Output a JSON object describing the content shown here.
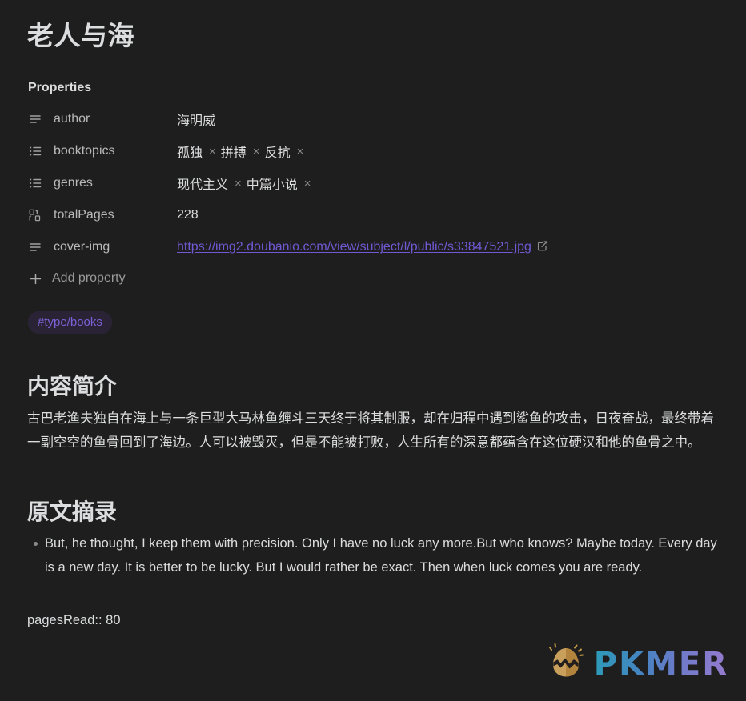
{
  "note": {
    "title": "老人与海"
  },
  "properties": {
    "heading": "Properties",
    "add_label": "Add property",
    "add_icon": "plus-icon",
    "rows": [
      {
        "key": "author",
        "icon": "text-lines-icon",
        "type": "text",
        "value": "海明威"
      },
      {
        "key": "booktopics",
        "icon": "bullet-list-icon",
        "type": "multi",
        "values": [
          "孤独",
          "拼搏",
          "反抗"
        ],
        "remove_glyph": "×"
      },
      {
        "key": "genres",
        "icon": "bullet-list-icon",
        "type": "multi",
        "values": [
          "现代主义",
          "中篇小说"
        ],
        "remove_glyph": "×"
      },
      {
        "key": "totalPages",
        "icon": "binary-number-icon",
        "type": "number",
        "value": "228"
      },
      {
        "key": "cover-img",
        "icon": "text-lines-icon",
        "type": "link",
        "value": "https://img2.doubanio.com/view/subject/l/public/s33847521.jpg",
        "link_icon": "external-link-icon"
      }
    ]
  },
  "tags": [
    {
      "label": "#type/books"
    }
  ],
  "sections": [
    {
      "heading": "内容简介",
      "paragraph": "古巴老渔夫独自在海上与一条巨型大马林鱼缠斗三天终于将其制服，却在归程中遇到鲨鱼的攻击，日夜奋战，最终带着一副空空的鱼骨回到了海边。人可以被毁灭，但是不能被打败，人生所有的深意都蕴含在这位硬汉和他的鱼骨之中。"
    },
    {
      "heading": "原文摘录",
      "quotes": [
        "But, he thought, I keep them with precision. Only I have no luck any more.But who knows? Maybe today. Every day is a new day. It is better to be lucky. But I would rather be exact. Then when luck comes you are ready."
      ]
    }
  ],
  "inline_field": {
    "text": "pagesRead:: 80"
  },
  "watermark": {
    "text": "PKMER",
    "icon": "pkmer-egg-logo"
  },
  "colors": {
    "background": "#1e1e1e",
    "text": "#dcddde",
    "muted_text": "#b9b9b9",
    "link": "#7159d4",
    "tag_text": "#7b61d6",
    "tag_background": "#2a2335",
    "bullet": "#8b8b8b"
  }
}
